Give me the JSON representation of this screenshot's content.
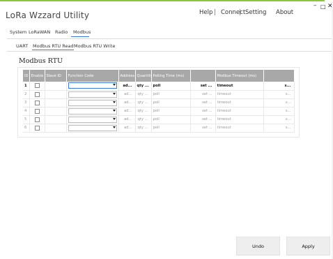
{
  "window": {
    "title": "LoRa Wzzard Utility",
    "minimize": "–",
    "maximize": "□",
    "close": "✕"
  },
  "menu": {
    "help": "Help",
    "sep": "|",
    "connect": "Connect",
    "setting": "Setting",
    "about": "About"
  },
  "tabs": [
    "System",
    "LoRaWAN",
    "Radio",
    "Modbus"
  ],
  "active_tab": "Modbus",
  "subtabs": [
    "UART",
    "Modbus RTU Read",
    "Modbus RTU Write"
  ],
  "active_subtab": "Modbus RTU Read",
  "section_title": "Modbus RTU",
  "table": {
    "headers": [
      "ID",
      "Enable",
      "Slave ID",
      "Function Code",
      "Address",
      "Quantity",
      "Polling Time (ms)",
      "",
      "Modbus Timeout (ms)",
      ""
    ],
    "rows": [
      {
        "id": "1",
        "address": "ad...",
        "quantity": "qty ...",
        "poll": "poll",
        "set": "set ...",
        "timeout": "timeout",
        "s": "s..."
      },
      {
        "id": "2",
        "address": "ad...",
        "quantity": "qty ...",
        "poll": "poll",
        "set": "set ...",
        "timeout": "timeout",
        "s": "s..."
      },
      {
        "id": "3",
        "address": "ad...",
        "quantity": "qty ...",
        "poll": "poll",
        "set": "set ...",
        "timeout": "timeout",
        "s": "s..."
      },
      {
        "id": "4",
        "address": "ad...",
        "quantity": "qty ...",
        "poll": "poll",
        "set": "set ...",
        "timeout": "timeout",
        "s": "s..."
      },
      {
        "id": "5",
        "address": "ad...",
        "quantity": "qty ...",
        "poll": "poll",
        "set": "set ...",
        "timeout": "timeout",
        "s": "s..."
      },
      {
        "id": "6",
        "address": "ad...",
        "quantity": "qty ...",
        "poll": "poll",
        "set": "set ...",
        "timeout": "timeout",
        "s": "s..."
      }
    ]
  },
  "buttons": {
    "undo": "Undo",
    "apply": "Apply"
  },
  "colors": {
    "accent_green": "#8cc63f",
    "tab_underline": "#3a7bd5",
    "header_bg": "#a8a8a8"
  }
}
